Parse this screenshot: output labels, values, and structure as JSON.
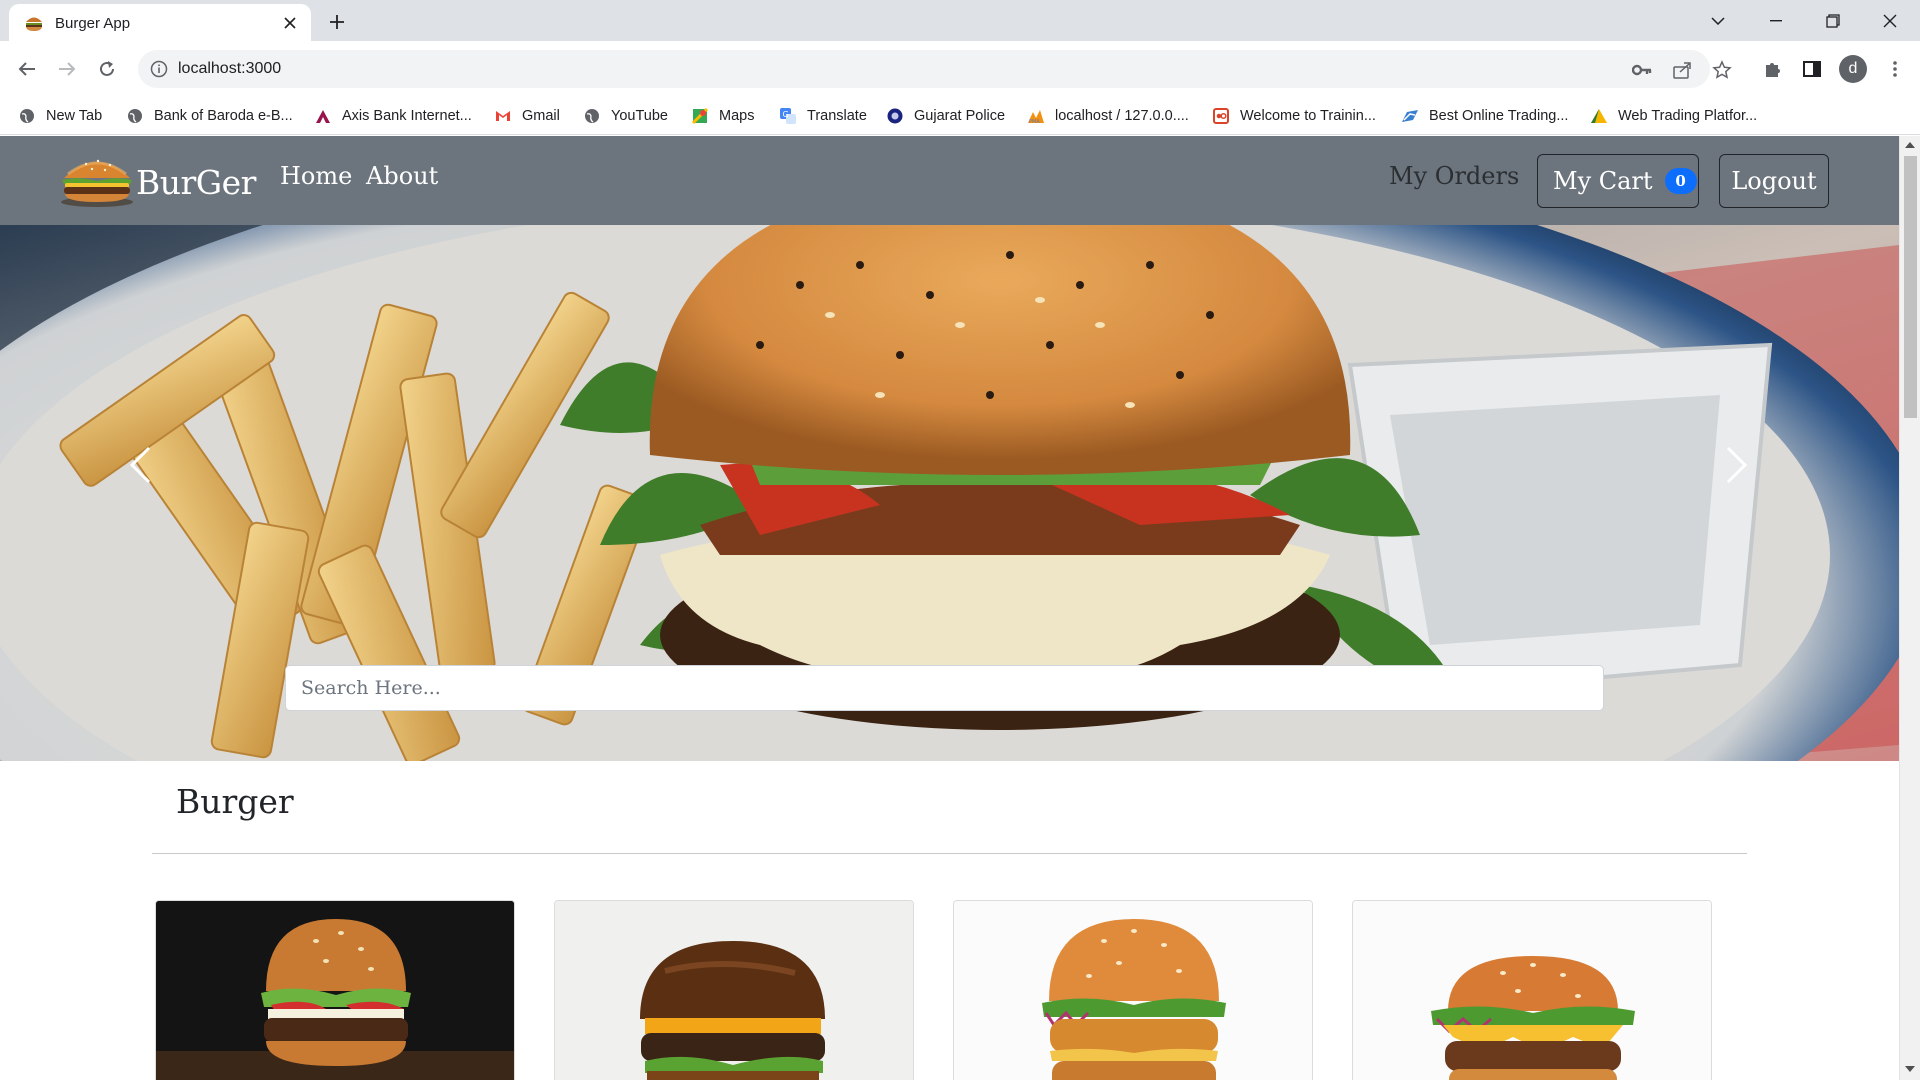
{
  "browser": {
    "tab_title": "Burger App",
    "url": "localhost:3000",
    "profile_initial": "d",
    "bookmarks": [
      {
        "label": "New Tab",
        "icon": "globe-icon"
      },
      {
        "label": "Bank of Baroda e-B...",
        "icon": "globe-icon"
      },
      {
        "label": "Axis Bank Internet...",
        "icon": "axis-bank-icon"
      },
      {
        "label": "Gmail",
        "icon": "gmail-icon"
      },
      {
        "label": "YouTube",
        "icon": "globe-icon"
      },
      {
        "label": "Maps",
        "icon": "maps-icon"
      },
      {
        "label": "Translate",
        "icon": "translate-icon"
      },
      {
        "label": "Gujarat Police",
        "icon": "police-badge-icon"
      },
      {
        "label": "localhost / 127.0.0....",
        "icon": "phpmyadmin-icon"
      },
      {
        "label": "Welcome to Trainin...",
        "icon": "training-icon"
      },
      {
        "label": "Best Online Trading...",
        "icon": "trading-icon"
      },
      {
        "label": "Web Trading Platfor...",
        "icon": "web-trading-icon"
      }
    ]
  },
  "site": {
    "brand": "BurGer",
    "nav_links": [
      "Home",
      "About"
    ],
    "my_orders": "My Orders",
    "cart_label": "My Cart",
    "cart_count": "0",
    "logout_label": "Logout",
    "search_placeholder": "Search Here...",
    "section_title": "Burger",
    "colors": {
      "navbar_bg": "#6c757d",
      "badge_bg": "#0d6efd"
    }
  }
}
